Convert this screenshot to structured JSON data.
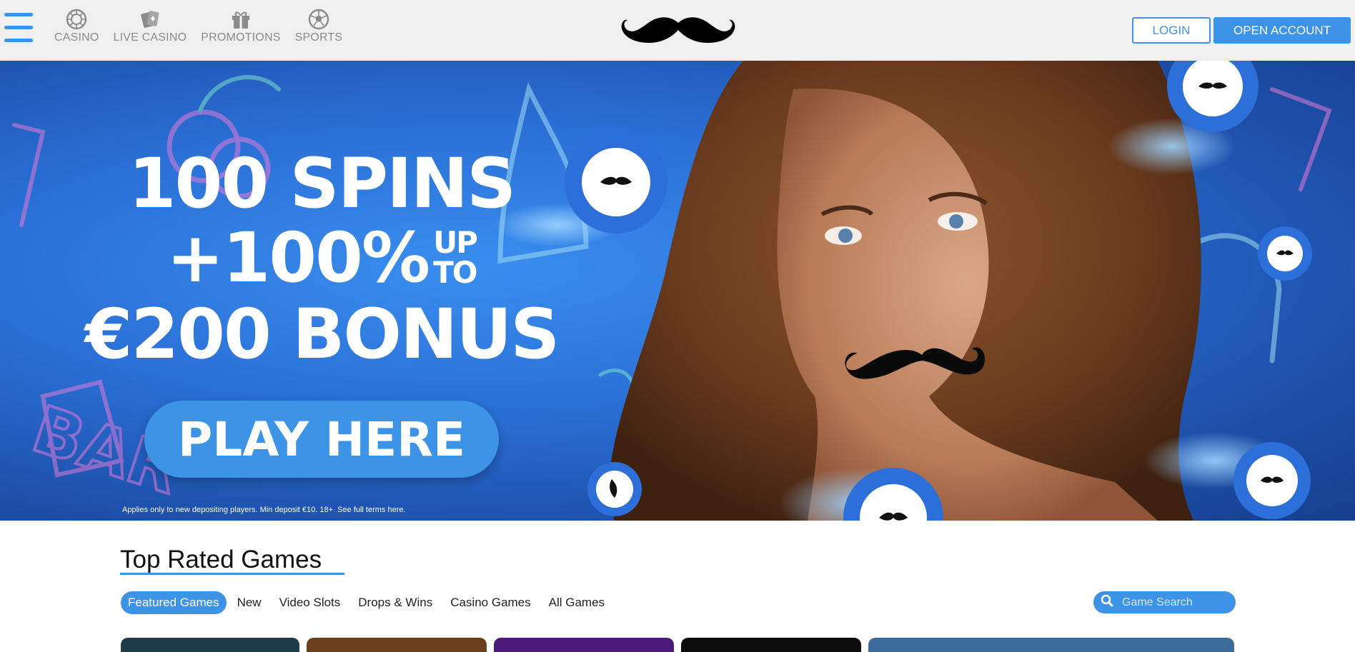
{
  "header": {
    "menu_icon": "hamburger-icon",
    "nav": [
      {
        "label": "CASINO",
        "icon": "roulette-icon"
      },
      {
        "label": "LIVE CASINO",
        "icon": "cards-icon"
      },
      {
        "label": "PROMOTIONS",
        "icon": "gift-icon"
      },
      {
        "label": "SPORTS",
        "icon": "soccer-ball-icon"
      }
    ],
    "logo_icon": "mustache-logo-icon",
    "login_label": "LOGIN",
    "open_account_label": "OPEN ACCOUNT"
  },
  "hero": {
    "line1": "100 SPINS",
    "line2": "+100%",
    "up": "UP",
    "to": "TO",
    "line3": "€200 BONUS",
    "cta_label": "PLAY HERE",
    "terms": "Applies only to new depositing players. Min deposit €10. 18+. See full terms here."
  },
  "games": {
    "title": "Top Rated Games",
    "tabs": [
      "Featured Games",
      "New",
      "Video Slots",
      "Drops & Wins",
      "Casino Games",
      "All Games"
    ],
    "active_tab": "Featured Games",
    "search_placeholder": "Game Search"
  },
  "colors": {
    "accent": "#3d93e6",
    "header_bg": "#f0f0f0",
    "nav_text": "#8b8b8b"
  }
}
